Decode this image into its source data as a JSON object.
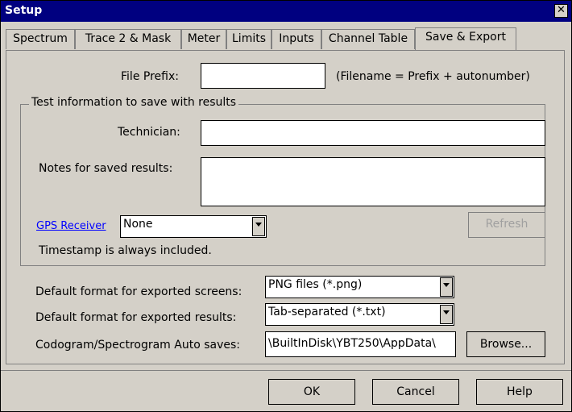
{
  "window": {
    "title": "Setup",
    "close_glyph": "✕"
  },
  "tabs": [
    {
      "label": "Spectrum"
    },
    {
      "label": "Trace 2 & Mask"
    },
    {
      "label": "Meter"
    },
    {
      "label": "Limits"
    },
    {
      "label": "Inputs"
    },
    {
      "label": "Channel Table"
    },
    {
      "label": "Save & Export",
      "active": true
    }
  ],
  "form": {
    "file_prefix_label": "File Prefix:",
    "file_prefix_value": "",
    "filename_hint": "(Filename = Prefix + autonumber)",
    "group_title": "Test information to save with results",
    "technician_label": "Technician:",
    "technician_value": "",
    "notes_label": "Notes for saved results:",
    "notes_value": "",
    "gps_link": "GPS Receiver",
    "gps_selected": "None",
    "refresh_label": "Refresh",
    "timestamp_note": "Timestamp is always included.",
    "screens_label": "Default format for exported screens:",
    "screens_selected": "PNG files (*.png)",
    "results_label": "Default format for exported results:",
    "results_selected": "Tab-separated (*.txt)",
    "autosave_label": "Codogram/Spectrogram Auto saves:",
    "autosave_path": "\\BuiltInDisk\\YBT250\\AppData\\",
    "browse_label": "Browse..."
  },
  "footer": {
    "ok_label": "OK",
    "cancel_label": "Cancel",
    "help_label": "Help"
  }
}
